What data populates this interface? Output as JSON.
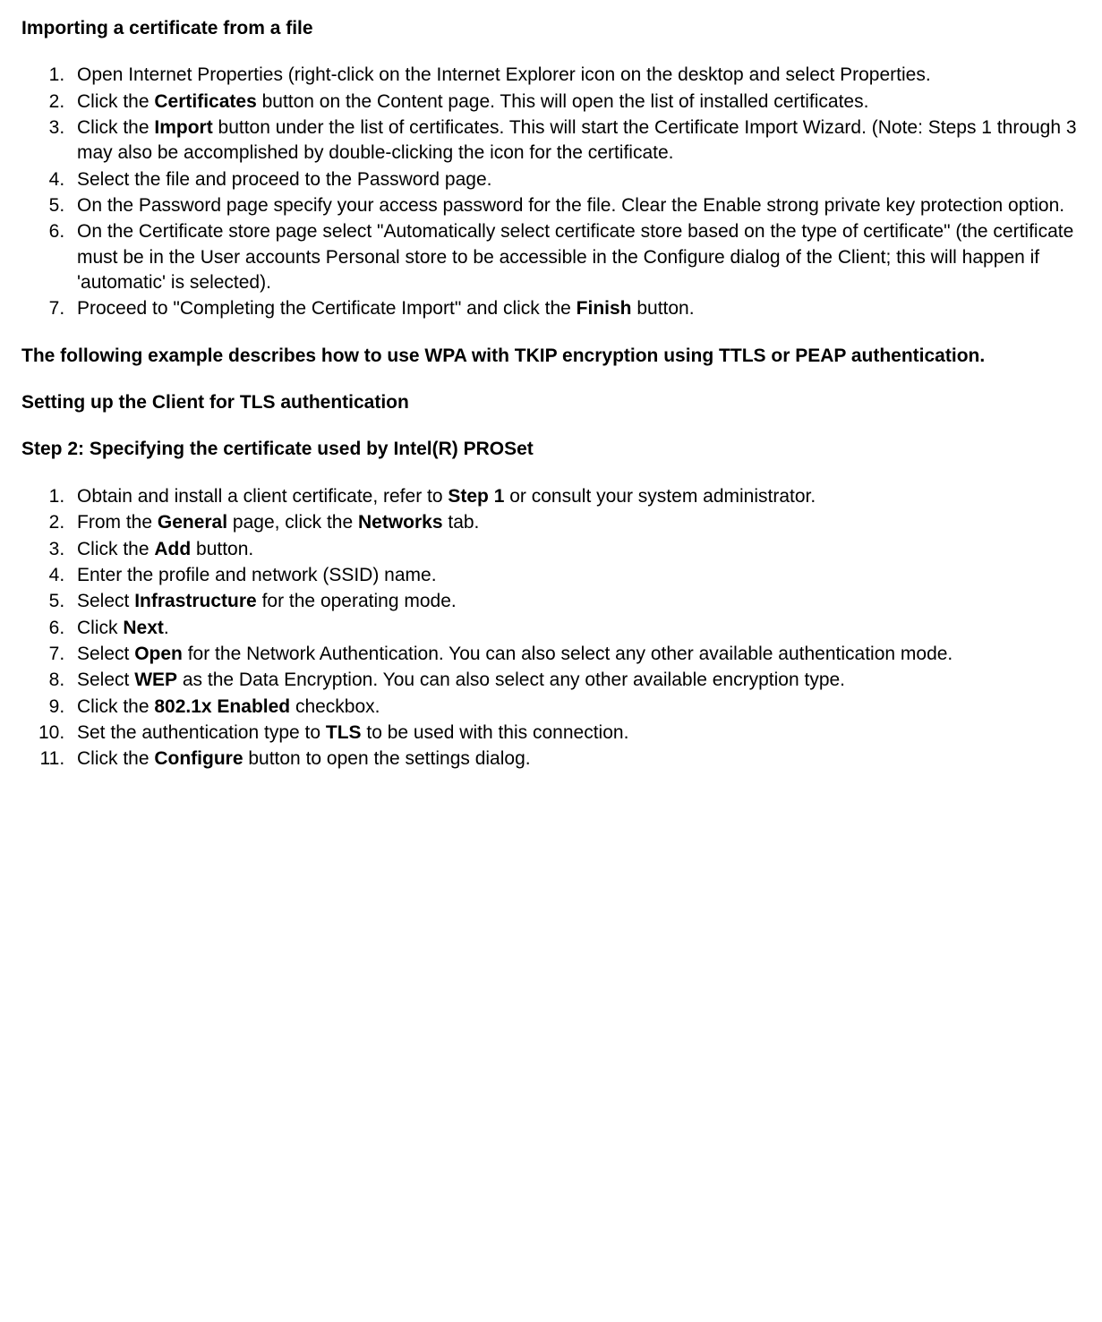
{
  "heading1": "Importing a certificate from a file",
  "list1": {
    "i1": "Open Internet Properties (right-click on the Internet Explorer icon on the desktop and select Properties.",
    "i2a": "Click the ",
    "i2b": "Certificates",
    "i2c": " button on the Content page. This will open the list of installed certificates.",
    "i3a": "Click the ",
    "i3b": "Import",
    "i3c": " button under the list of certificates. This will start the Certificate Import Wizard. (Note: Steps 1 through 3 may also be accomplished by double-clicking the icon for the certificate.",
    "i4": "Select the file and proceed to the Password page.",
    "i5": "On the Password page specify your access password for the file. Clear the Enable strong private key protection option.",
    "i6": "On the Certificate store page select \"Automatically select certificate store based on the type of certificate\" (the certificate must be in the User accounts Personal store to be accessible in the Configure dialog of the Client; this will happen if 'automatic' is selected).",
    "i7a": "Proceed to \"Completing the Certificate Import\" and click the ",
    "i7b": "Finish",
    "i7c": " button."
  },
  "heading2": "The following example describes how to use WPA with TKIP encryption using TTLS or PEAP authentication.",
  "heading3": "Setting up the Client for TLS authentication",
  "heading4": "Step 2: Specifying the certificate used by Intel(R) PROSet",
  "list2": {
    "i1a": "Obtain and install a client certificate, refer to ",
    "i1b": "Step 1",
    "i1c": " or consult your system administrator.",
    "i2a": "From the ",
    "i2b": "General",
    "i2c": " page, click the ",
    "i2d": "Networks",
    "i2e": " tab.",
    "i3a": "Click the ",
    "i3b": "Add",
    "i3c": " button.",
    "i4": "Enter the profile and network (SSID) name.",
    "i5a": "Select ",
    "i5b": "Infrastructure",
    "i5c": " for the operating mode.",
    "i6a": "Click ",
    "i6b": "Next",
    "i6c": ".",
    "i7a": "Select ",
    "i7b": "Open",
    "i7c": " for the Network Authentication. You can also select any other available authentication mode.",
    "i8a": "Select ",
    "i8b": "WEP",
    "i8c": " as the Data Encryption. You can also select any other available encryption type.",
    "i9a": "Click the ",
    "i9b": "802.1x Enabled",
    "i9c": " checkbox.",
    "i10a": "Set the authentication type to ",
    "i10b": "TLS",
    "i10c": " to be used with this connection.",
    "i11a": "Click the ",
    "i11b": "Configure",
    "i11c": " button to open the settings dialog."
  }
}
